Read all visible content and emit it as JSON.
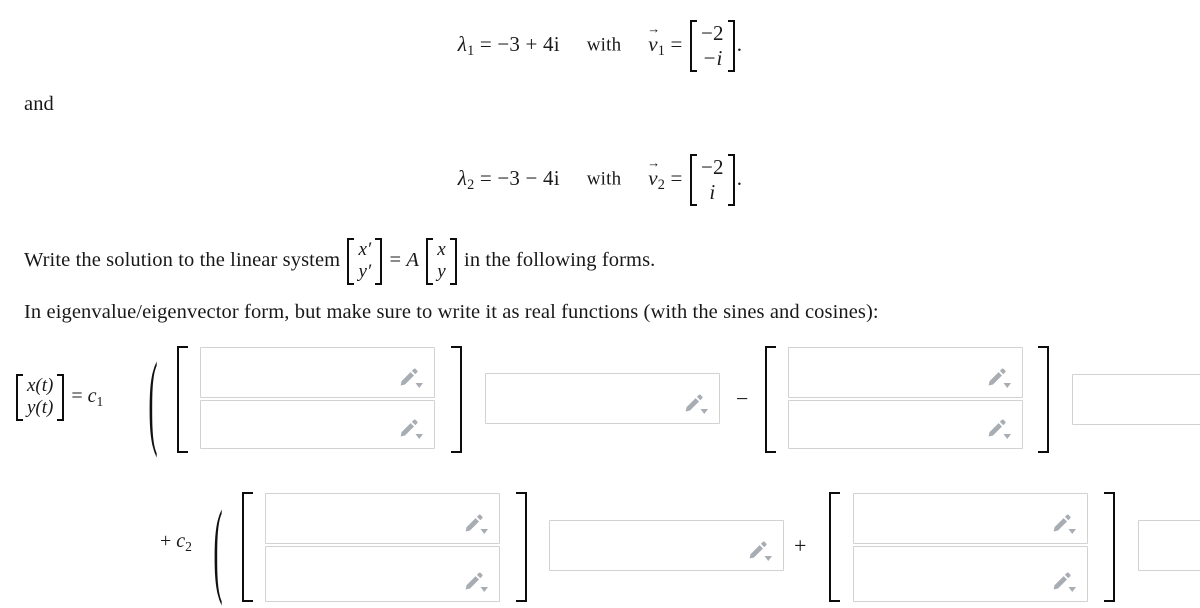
{
  "equations": {
    "eigen1": {
      "lambda": "λ",
      "lambda_sub": "1",
      "equals": "=",
      "value": "−3 + 4i",
      "with": "with",
      "vec": "v",
      "vec_sub": "1",
      "matrix": [
        "−2",
        "−i"
      ],
      "period": "."
    },
    "and_text": "and",
    "eigen2": {
      "lambda": "λ",
      "lambda_sub": "2",
      "equals": "=",
      "value": "−3 − 4i",
      "with": "with",
      "vec": "v",
      "vec_sub": "2",
      "matrix": [
        "−2",
        "i"
      ],
      "period": "."
    }
  },
  "prompt": {
    "line1_before": "Write the solution to the linear system",
    "line1_matrix_lhs": [
      "x′",
      "y′"
    ],
    "line1_equals": "=",
    "line1_A": "A",
    "line1_matrix_rhs": [
      "x",
      "y"
    ],
    "line1_after": "in the following forms.",
    "line2": "In eigenvalue/eigenvector form, but make sure to write it as real functions (with the sines and cosines):"
  },
  "solution": {
    "lhs_matrix": [
      "x(t)",
      "y(t)"
    ],
    "equals": "=",
    "coef1": "c",
    "coef1_sub": "1",
    "coef2": "c",
    "coef2_sub": "2",
    "plus": "+",
    "open_paren": "(",
    "row1_operator": "−",
    "row2_operator": "+",
    "inputs": {
      "row1_vec1_top": "",
      "row1_vec1_bottom": "",
      "row1_scalar": "",
      "row1_vec2_top": "",
      "row1_vec2_bottom": "",
      "row1_trailing": "",
      "row2_vec1_top": "",
      "row2_vec1_bottom": "",
      "row2_scalar": "",
      "row2_vec2_top": "",
      "row2_vec2_bottom": "",
      "row2_trailing": ""
    },
    "input_placeholder": ""
  },
  "icons": {
    "pencil": "pencil-icon",
    "dropdown": "chevron-down-icon"
  },
  "colors": {
    "text": "#1a1a1a",
    "input_border": "#d2d2d2",
    "bracket": "#0d0d0d",
    "icon_gray": "#a8adb3",
    "page_background": "#ffffff"
  }
}
